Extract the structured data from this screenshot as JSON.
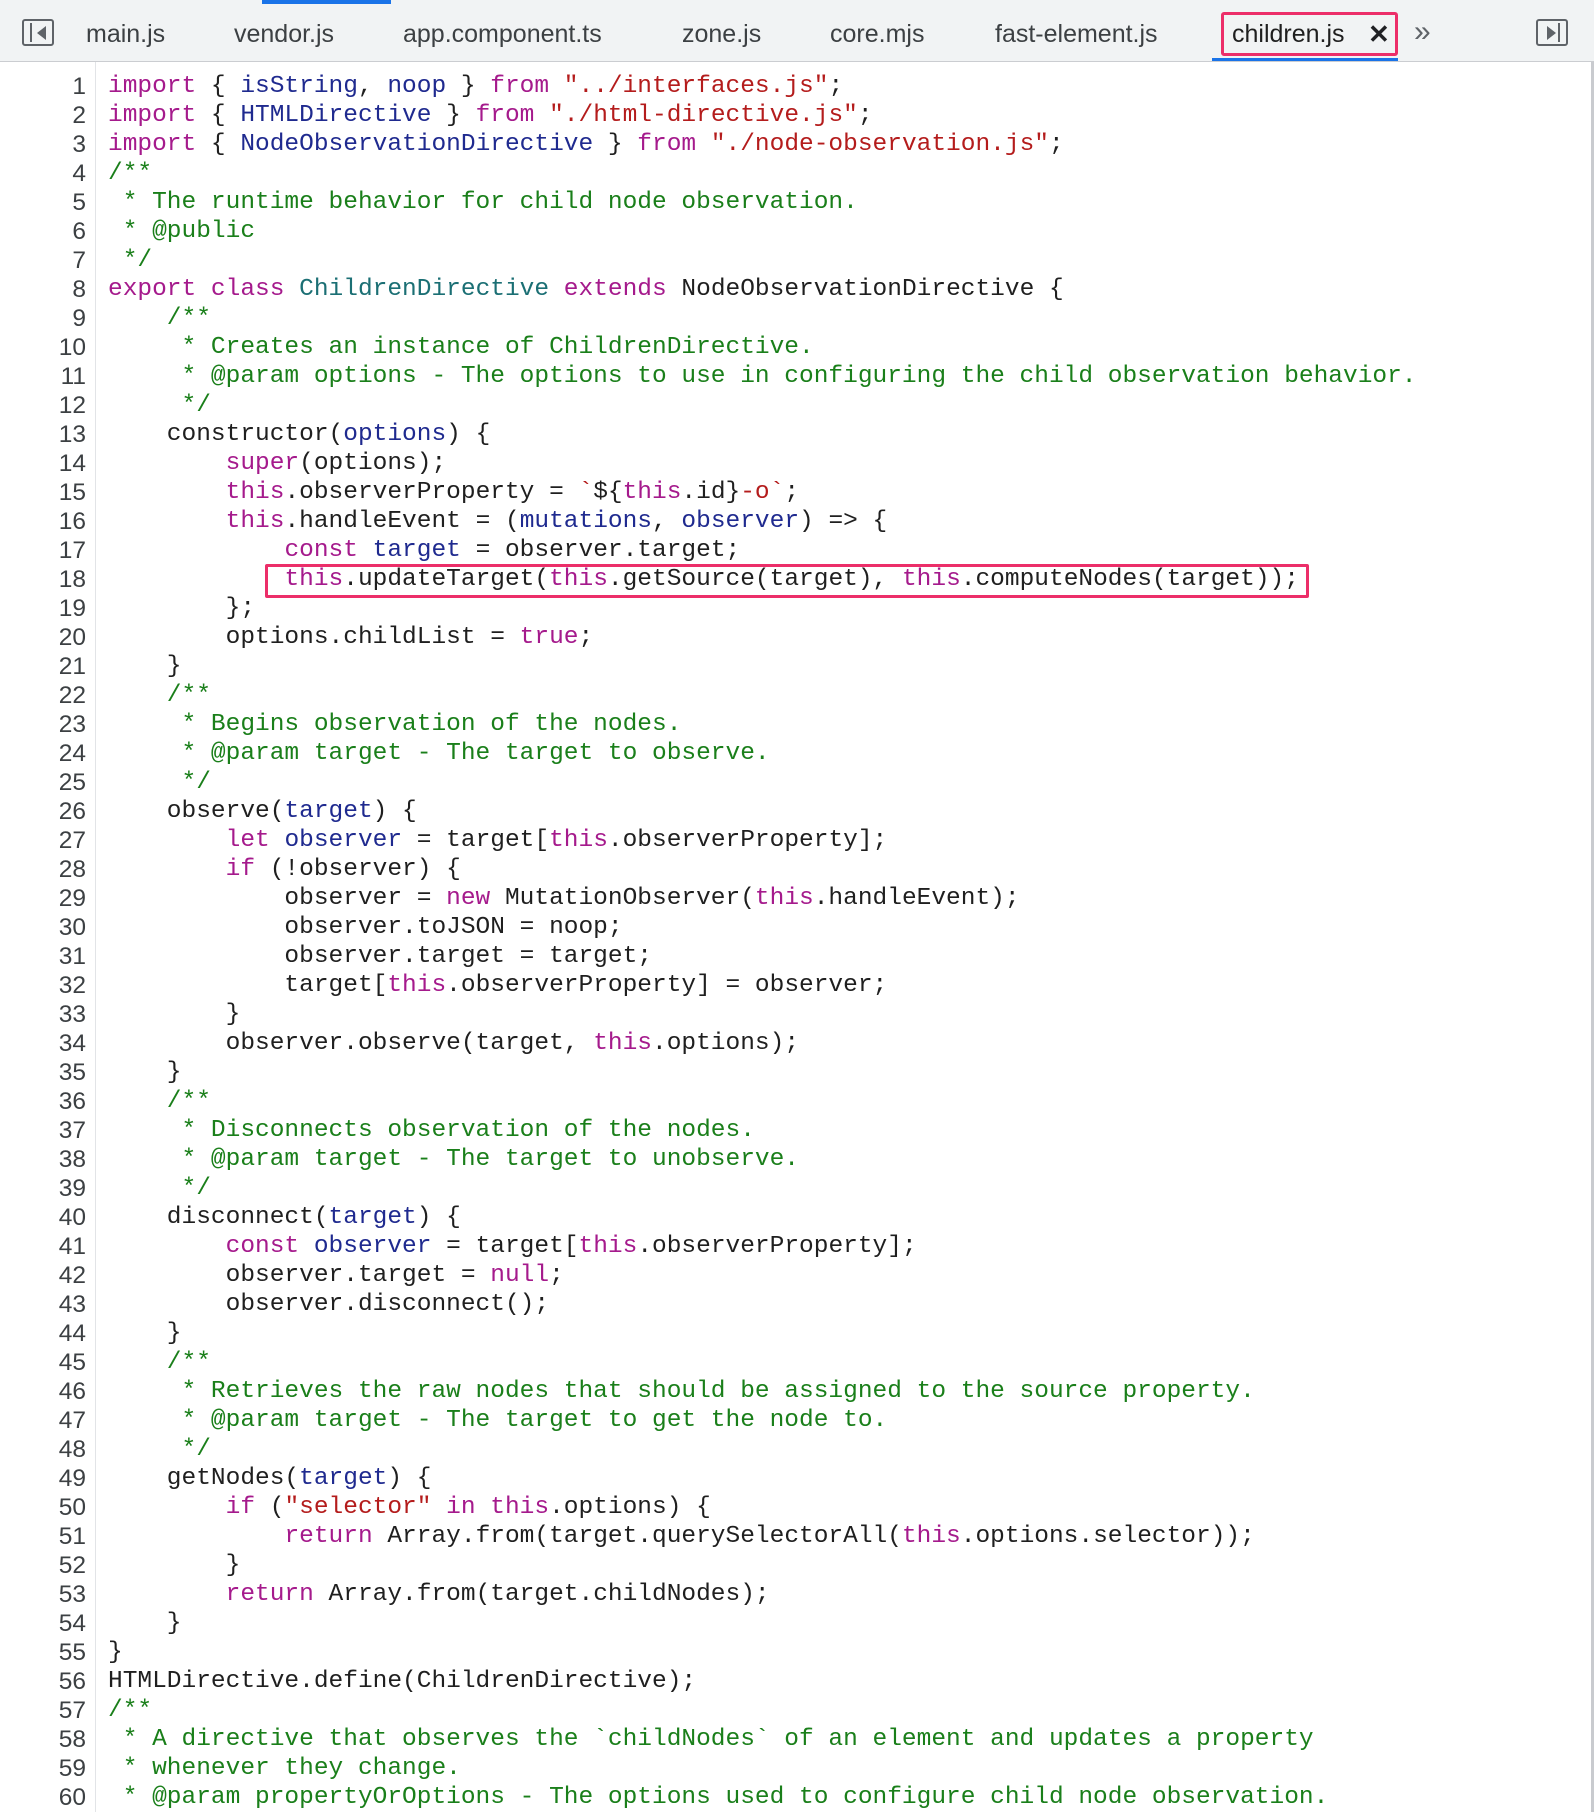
{
  "tabs": [
    {
      "label": "main.js",
      "active": false
    },
    {
      "label": "vendor.js",
      "active": false
    },
    {
      "label": "app.component.ts",
      "active": false
    },
    {
      "label": "zone.js",
      "active": false
    },
    {
      "label": "core.mjs",
      "active": false
    },
    {
      "label": "fast-element.js",
      "active": false
    },
    {
      "label": "children.js",
      "active": true
    }
  ],
  "close_glyph": "✕",
  "more_tabs_glyph": "»",
  "colors": {
    "keyword": "#a51a8c",
    "string": "#b41c1c",
    "comment": "#1a7f1a",
    "variable": "#1f2a8f",
    "class_name": "#1b6f74",
    "highlight": "#ec2e69",
    "active_tab_underline": "#1a73e8"
  },
  "icons": {
    "left": "navigator-toggle-icon",
    "right": "debugger-panel-toggle-icon"
  },
  "highlighted_line": 18,
  "code_lines": [
    [
      [
        "kw",
        "import"
      ],
      [
        "pl",
        " { "
      ],
      [
        "vd",
        "isString"
      ],
      [
        "pl",
        ", "
      ],
      [
        "vd",
        "noop"
      ],
      [
        "pl",
        " } "
      ],
      [
        "kw",
        "from"
      ],
      [
        "pl",
        " "
      ],
      [
        "str",
        "\"../interfaces.js\""
      ],
      [
        "pl",
        ";"
      ]
    ],
    [
      [
        "kw",
        "import"
      ],
      [
        "pl",
        " { "
      ],
      [
        "vd",
        "HTMLDirective"
      ],
      [
        "pl",
        " } "
      ],
      [
        "kw",
        "from"
      ],
      [
        "pl",
        " "
      ],
      [
        "str",
        "\"./html-directive.js\""
      ],
      [
        "pl",
        ";"
      ]
    ],
    [
      [
        "kw",
        "import"
      ],
      [
        "pl",
        " { "
      ],
      [
        "vd",
        "NodeObservationDirective"
      ],
      [
        "pl",
        " } "
      ],
      [
        "kw",
        "from"
      ],
      [
        "pl",
        " "
      ],
      [
        "str",
        "\"./node-observation.js\""
      ],
      [
        "pl",
        ";"
      ]
    ],
    [
      [
        "cm",
        "/**"
      ]
    ],
    [
      [
        "cm",
        " * The runtime behavior for child node observation."
      ]
    ],
    [
      [
        "cm",
        " * @public"
      ]
    ],
    [
      [
        "cm",
        " */"
      ]
    ],
    [
      [
        "kw",
        "export"
      ],
      [
        "pl",
        " "
      ],
      [
        "kw",
        "class"
      ],
      [
        "pl",
        " "
      ],
      [
        "cls",
        "ChildrenDirective"
      ],
      [
        "pl",
        " "
      ],
      [
        "kw",
        "extends"
      ],
      [
        "pl",
        " NodeObservationDirective {"
      ]
    ],
    [
      [
        "cm",
        "    /**"
      ]
    ],
    [
      [
        "cm",
        "     * Creates an instance of ChildrenDirective."
      ]
    ],
    [
      [
        "cm",
        "     * @param options - The options to use in configuring the child observation behavior."
      ]
    ],
    [
      [
        "cm",
        "     */"
      ]
    ],
    [
      [
        "pl",
        "    constructor("
      ],
      [
        "vd",
        "options"
      ],
      [
        "pl",
        ") {"
      ]
    ],
    [
      [
        "pl",
        "        "
      ],
      [
        "kw",
        "super"
      ],
      [
        "pl",
        "(options);"
      ]
    ],
    [
      [
        "pl",
        "        "
      ],
      [
        "kw",
        "this"
      ],
      [
        "pl",
        ".observerProperty = "
      ],
      [
        "str",
        "`"
      ],
      [
        "pl",
        "${"
      ],
      [
        "kw",
        "this"
      ],
      [
        "pl",
        ".id}"
      ],
      [
        "str",
        "-o`"
      ],
      [
        "pl",
        ";"
      ]
    ],
    [
      [
        "pl",
        "        "
      ],
      [
        "kw",
        "this"
      ],
      [
        "pl",
        ".handleEvent = ("
      ],
      [
        "vd",
        "mutations"
      ],
      [
        "pl",
        ", "
      ],
      [
        "vd",
        "observer"
      ],
      [
        "pl",
        ") => {"
      ]
    ],
    [
      [
        "pl",
        "            "
      ],
      [
        "kw",
        "const"
      ],
      [
        "pl",
        " "
      ],
      [
        "vd",
        "target"
      ],
      [
        "pl",
        " = observer.target;"
      ]
    ],
    [
      [
        "pl",
        "            "
      ],
      [
        "kw",
        "this"
      ],
      [
        "pl",
        ".updateTarget("
      ],
      [
        "kw",
        "this"
      ],
      [
        "pl",
        ".getSource(target), "
      ],
      [
        "kw",
        "this"
      ],
      [
        "pl",
        ".computeNodes(target));"
      ]
    ],
    [
      [
        "pl",
        "        };"
      ]
    ],
    [
      [
        "pl",
        "        options.childList = "
      ],
      [
        "kw",
        "true"
      ],
      [
        "pl",
        ";"
      ]
    ],
    [
      [
        "pl",
        "    }"
      ]
    ],
    [
      [
        "cm",
        "    /**"
      ]
    ],
    [
      [
        "cm",
        "     * Begins observation of the nodes."
      ]
    ],
    [
      [
        "cm",
        "     * @param target - The target to observe."
      ]
    ],
    [
      [
        "cm",
        "     */"
      ]
    ],
    [
      [
        "pl",
        "    observe("
      ],
      [
        "vd",
        "target"
      ],
      [
        "pl",
        ") {"
      ]
    ],
    [
      [
        "pl",
        "        "
      ],
      [
        "kw",
        "let"
      ],
      [
        "pl",
        " "
      ],
      [
        "vd",
        "observer"
      ],
      [
        "pl",
        " = target["
      ],
      [
        "kw",
        "this"
      ],
      [
        "pl",
        ".observerProperty];"
      ]
    ],
    [
      [
        "pl",
        "        "
      ],
      [
        "kw",
        "if"
      ],
      [
        "pl",
        " (!observer) {"
      ]
    ],
    [
      [
        "pl",
        "            observer = "
      ],
      [
        "kw",
        "new"
      ],
      [
        "pl",
        " MutationObserver("
      ],
      [
        "kw",
        "this"
      ],
      [
        "pl",
        ".handleEvent);"
      ]
    ],
    [
      [
        "pl",
        "            observer.toJSON = noop;"
      ]
    ],
    [
      [
        "pl",
        "            observer.target = target;"
      ]
    ],
    [
      [
        "pl",
        "            target["
      ],
      [
        "kw",
        "this"
      ],
      [
        "pl",
        ".observerProperty] = observer;"
      ]
    ],
    [
      [
        "pl",
        "        }"
      ]
    ],
    [
      [
        "pl",
        "        observer.observe(target, "
      ],
      [
        "kw",
        "this"
      ],
      [
        "pl",
        ".options);"
      ]
    ],
    [
      [
        "pl",
        "    }"
      ]
    ],
    [
      [
        "cm",
        "    /**"
      ]
    ],
    [
      [
        "cm",
        "     * Disconnects observation of the nodes."
      ]
    ],
    [
      [
        "cm",
        "     * @param target - The target to unobserve."
      ]
    ],
    [
      [
        "cm",
        "     */"
      ]
    ],
    [
      [
        "pl",
        "    disconnect("
      ],
      [
        "vd",
        "target"
      ],
      [
        "pl",
        ") {"
      ]
    ],
    [
      [
        "pl",
        "        "
      ],
      [
        "kw",
        "const"
      ],
      [
        "pl",
        " "
      ],
      [
        "vd",
        "observer"
      ],
      [
        "pl",
        " = target["
      ],
      [
        "kw",
        "this"
      ],
      [
        "pl",
        ".observerProperty];"
      ]
    ],
    [
      [
        "pl",
        "        observer.target = "
      ],
      [
        "kw",
        "null"
      ],
      [
        "pl",
        ";"
      ]
    ],
    [
      [
        "pl",
        "        observer.disconnect();"
      ]
    ],
    [
      [
        "pl",
        "    }"
      ]
    ],
    [
      [
        "cm",
        "    /**"
      ]
    ],
    [
      [
        "cm",
        "     * Retrieves the raw nodes that should be assigned to the source property."
      ]
    ],
    [
      [
        "cm",
        "     * @param target - The target to get the node to."
      ]
    ],
    [
      [
        "cm",
        "     */"
      ]
    ],
    [
      [
        "pl",
        "    getNodes("
      ],
      [
        "vd",
        "target"
      ],
      [
        "pl",
        ") {"
      ]
    ],
    [
      [
        "pl",
        "        "
      ],
      [
        "kw",
        "if"
      ],
      [
        "pl",
        " ("
      ],
      [
        "str",
        "\"selector\""
      ],
      [
        "pl",
        " "
      ],
      [
        "kw",
        "in"
      ],
      [
        "pl",
        " "
      ],
      [
        "kw",
        "this"
      ],
      [
        "pl",
        ".options) {"
      ]
    ],
    [
      [
        "pl",
        "            "
      ],
      [
        "kw",
        "return"
      ],
      [
        "pl",
        " Array.from(target.querySelectorAll("
      ],
      [
        "kw",
        "this"
      ],
      [
        "pl",
        ".options.selector));"
      ]
    ],
    [
      [
        "pl",
        "        }"
      ]
    ],
    [
      [
        "pl",
        "        "
      ],
      [
        "kw",
        "return"
      ],
      [
        "pl",
        " Array.from(target.childNodes);"
      ]
    ],
    [
      [
        "pl",
        "    }"
      ]
    ],
    [
      [
        "pl",
        "}"
      ]
    ],
    [
      [
        "pl",
        "HTMLDirective.define(ChildrenDirective);"
      ]
    ],
    [
      [
        "cm",
        "/**"
      ]
    ],
    [
      [
        "cm",
        " * A directive that observes the `childNodes` of an element and updates a property"
      ]
    ],
    [
      [
        "cm",
        " * whenever they change."
      ]
    ],
    [
      [
        "cm",
        " * @param propertyOrOptions - The options used to configure child node observation."
      ]
    ]
  ]
}
